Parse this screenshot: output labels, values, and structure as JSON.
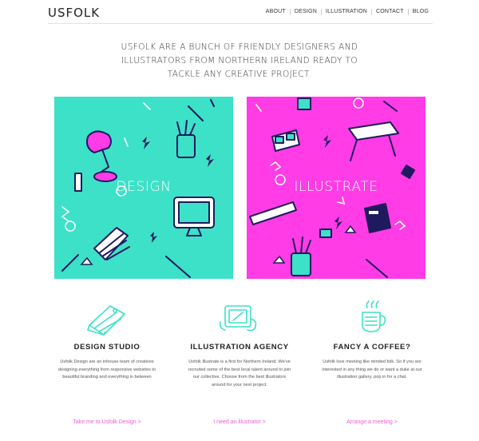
{
  "header": {
    "logo": "USFOLK",
    "nav": [
      "ABOUT",
      "DESIGN",
      "ILLUSTRATION",
      "CONTACT",
      "BLOG"
    ]
  },
  "intro": "USFOLK ARE A BUNCH OF FRIENDLY DESIGNERS AND ILLUSTRATORS FROM NORTHERN IRELAND READY TO TACKLE ANY CREATIVE PROJECT.",
  "panels": {
    "design": {
      "label": "DESIGN",
      "color": "#3ce1c8"
    },
    "illustrate": {
      "label": "ILLUSTRATE",
      "color": "#ff3ce5"
    }
  },
  "features": [
    {
      "title": "DESIGN STUDIO",
      "text": "Usfolk Design are an inhouse team of creatives designing everything from responsive websites to beautiful branding and everything in between",
      "cta": "Take me to Usfolk Design  >",
      "icon": "swatch-book-icon"
    },
    {
      "title": "ILLUSTRATION AGENCY",
      "text": "Usfolk Illustrate is a first for Northern Ireland. We've recruited some of the best local talent around to join our collective. Choose from the best illustrators around for your next project.",
      "cta": "I need an illustrator  >",
      "icon": "drawing-tablet-icon"
    },
    {
      "title": "FANCY A COFFEE?",
      "text": "Usfolk love meeting like minded folk. So if you are interested in any thing we do or want a duke at our illustration gallery, pop in for a chat.",
      "cta": "Arrange a meeting  >",
      "icon": "coffee-cup-icon"
    }
  ],
  "colors": {
    "teal": "#3ce1c8",
    "pink": "#ff3ce5",
    "link": "#ee5ad8",
    "ink": "#1f1a5e"
  }
}
